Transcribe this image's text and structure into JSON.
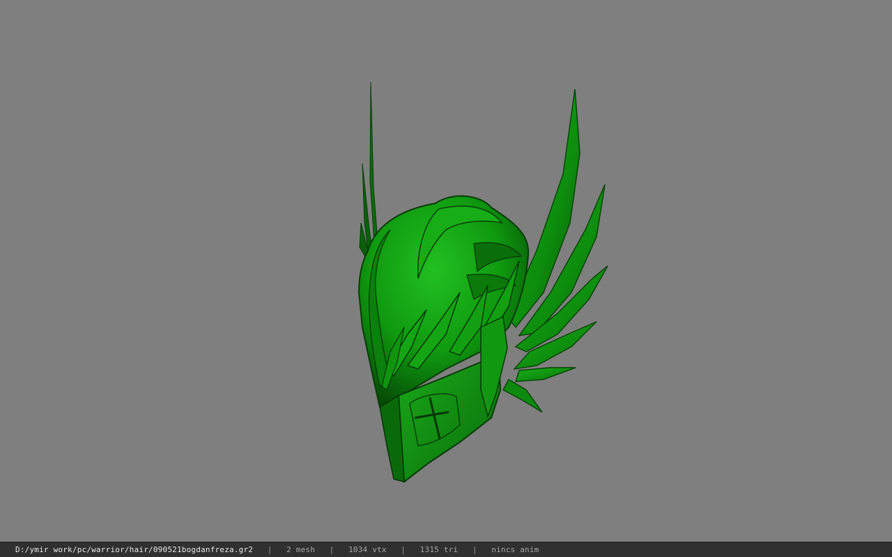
{
  "viewer": {
    "background_color": "#7f7f7f",
    "model": {
      "name": "helmet-model",
      "color": "#0f9a0f"
    }
  },
  "status": {
    "file_path": "D:/ymir work/pc/warrior/hair/090521bogdanfreza.gr2",
    "separator": "|",
    "mesh": "2 mesh",
    "vertices": "1034 vtx",
    "triangles": "1315 tri",
    "anim": "nincs anim"
  }
}
